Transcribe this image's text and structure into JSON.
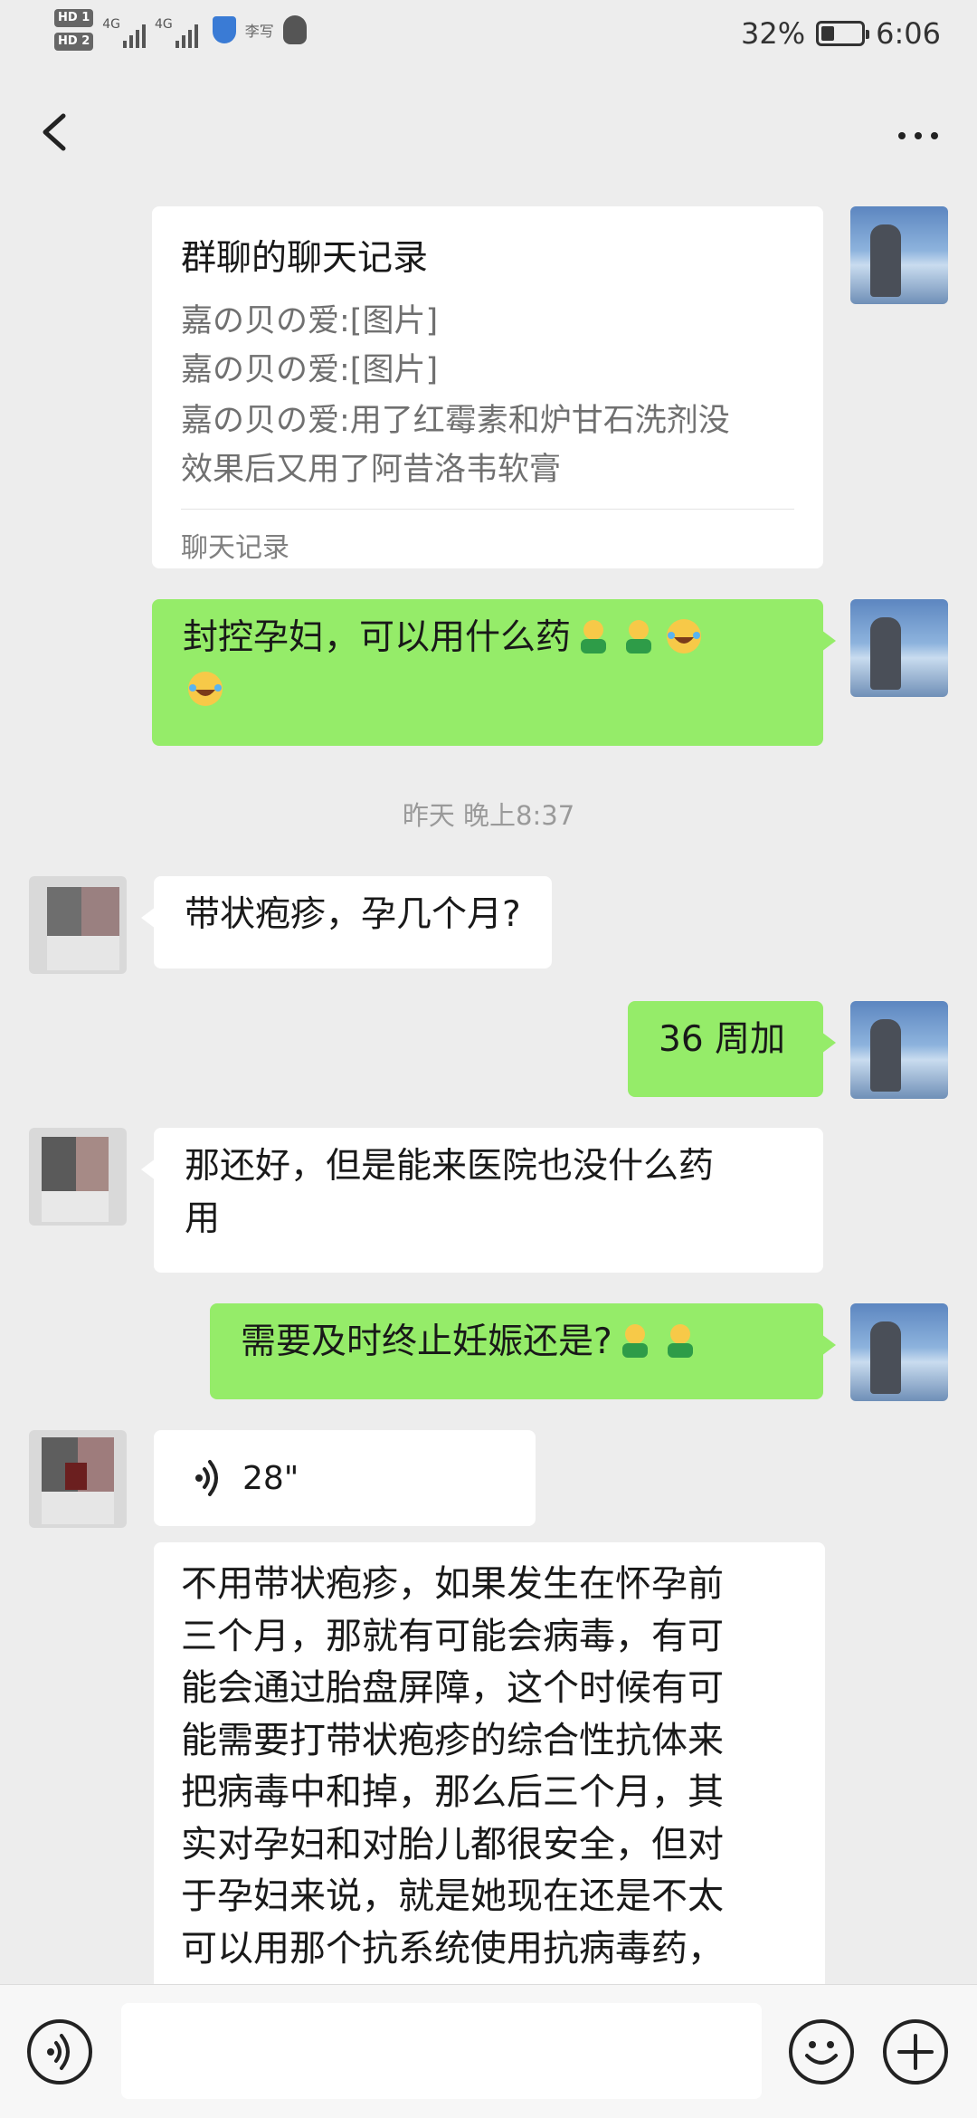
{
  "status_bar": {
    "hd1": "HD 1",
    "hd2": "HD 2",
    "net1": "4G",
    "net2": "4G",
    "carrier_text": "李写",
    "battery": "32%",
    "battery_level": 0.32,
    "time": "6:06"
  },
  "header": {
    "back_icon": "chevron-left-icon",
    "more_icon": "more-dots-icon"
  },
  "messages": {
    "record": {
      "title": "群聊的聊天记录",
      "lines": [
        "嘉の贝の爱:[图片]",
        "嘉の贝の爱:[图片]",
        "嘉の贝の爱:用了红霉素和炉甘石洗剂没",
        "效果后又用了阿昔洛韦软膏"
      ],
      "footer": "聊天记录"
    },
    "m1": {
      "line1": "封控孕妇，可以用什么药",
      "line2": ""
    },
    "timestamp": "昨天 晚上8:37",
    "m2": "带状疱疹，孕几个月?",
    "m3": "36 周加",
    "m4": {
      "line1": "那还好，但是能来医院也没什么药",
      "line2": "用"
    },
    "m5": "需要及时终止妊娠还是?",
    "voice": "28\"",
    "m6": [
      "不用带状疱疹，如果发生在怀孕前",
      "三个月，那就有可能会病毒，有可",
      "能会通过胎盘屏障，这个时候有可",
      "能需要打带状疱疹的综合性抗体来",
      "把病毒中和掉，那么后三个月，其",
      "实对孕妇和对胎儿都很安全，但对",
      "于孕妇来说，就是她现在还是不太",
      "可以用那个抗系统使用抗病毒药，"
    ]
  },
  "input_bar": {
    "voice_icon": "voice-input-icon",
    "emoji_icon": "emoji-icon",
    "add_icon": "plus-icon"
  },
  "colors": {
    "background": "#ededed",
    "my_bubble": "#95ec69",
    "other_bubble": "#ffffff"
  }
}
